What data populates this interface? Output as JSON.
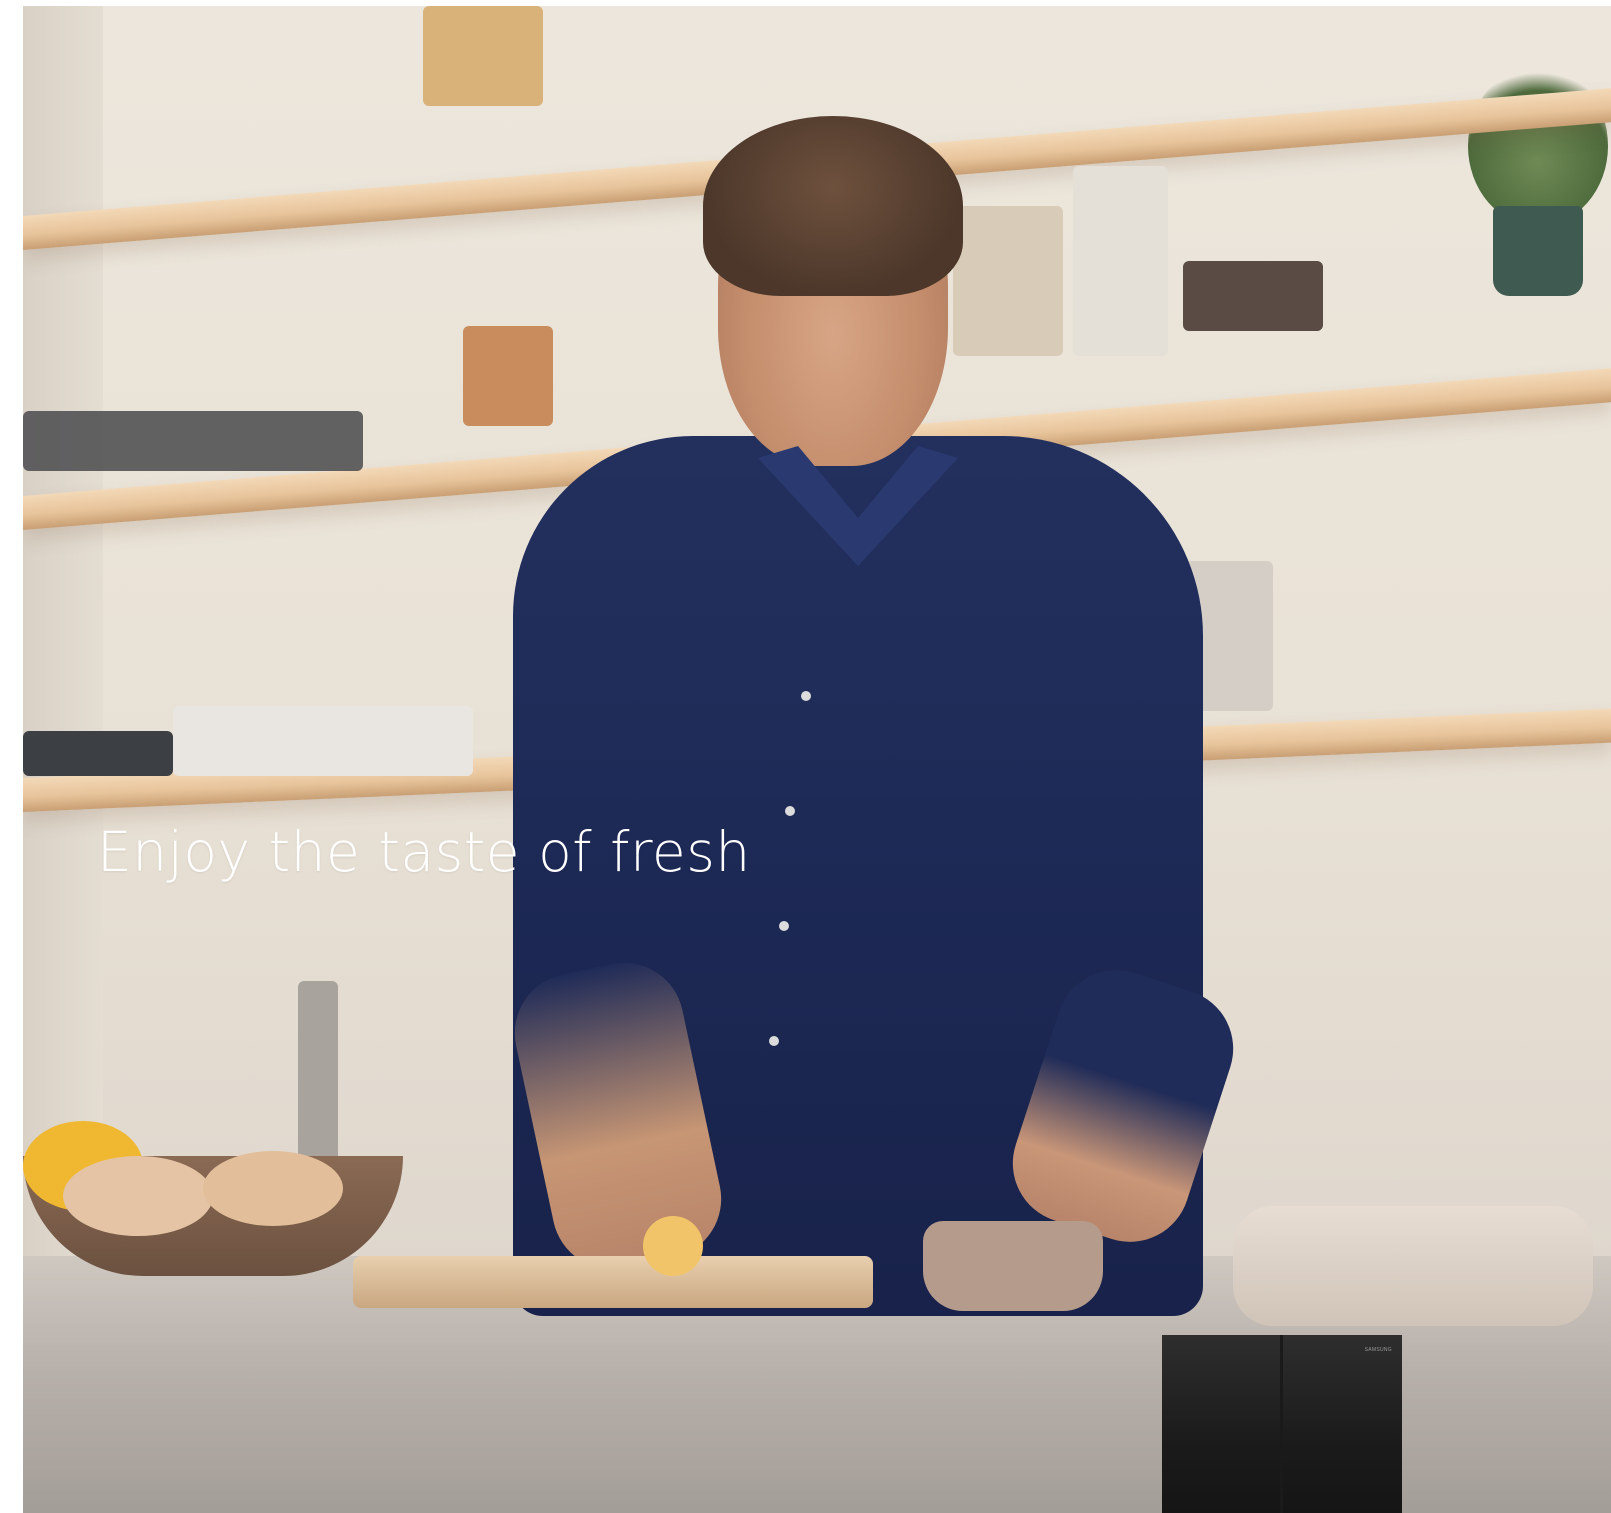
{
  "hero": {
    "tagline": "Enjoy the taste of fresh"
  },
  "product": {
    "brand_mark": "SAMSUNG"
  },
  "colors": {
    "shirt": "#1d2955",
    "shelf_wood": "#e8c49b",
    "wall": "#ece6dc",
    "tagline_text": "#ffffff",
    "fridge": "#1b1b1b"
  }
}
